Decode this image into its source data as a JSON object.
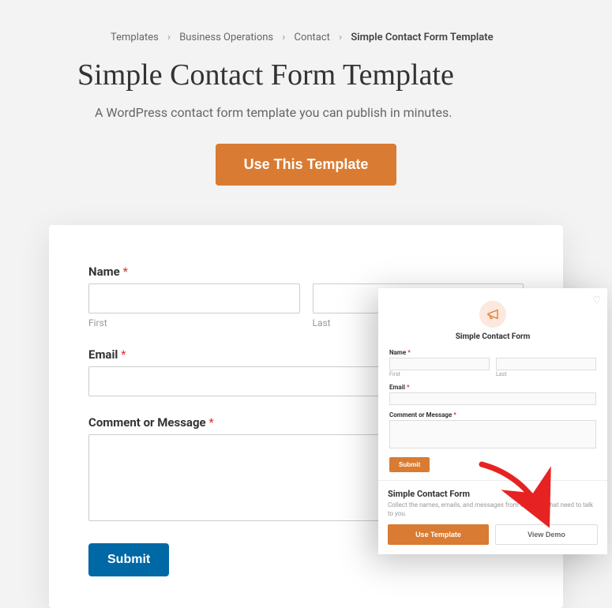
{
  "breadcrumb": {
    "items": [
      "Templates",
      "Business Operations",
      "Contact"
    ],
    "current": "Simple Contact Form Template",
    "sep": "›"
  },
  "page_title": "Simple Contact Form Template",
  "subtitle": "A WordPress contact form template you can publish in minutes.",
  "cta_label": "Use This Template",
  "form": {
    "name_label": "Name",
    "first_sub": "First",
    "last_sub": "Last",
    "email_label": "Email",
    "comment_label": "Comment or Message",
    "submit_label": "Submit",
    "required_mark": "*"
  },
  "popup": {
    "title": "Simple Contact Form",
    "name_label": "Name",
    "first_sub": "First",
    "last_sub": "Last",
    "email_label": "Email",
    "comment_label": "Comment or Message",
    "submit_label": "Submit",
    "required_mark": "*",
    "card_title": "Simple Contact Form",
    "card_desc": "Collect the names, emails, and messages from the users that need to talk to you.",
    "use_template_label": "Use Template",
    "view_demo_label": "View Demo"
  },
  "colors": {
    "accent": "#d97b32",
    "submit": "#0068a5",
    "required": "#d33"
  }
}
